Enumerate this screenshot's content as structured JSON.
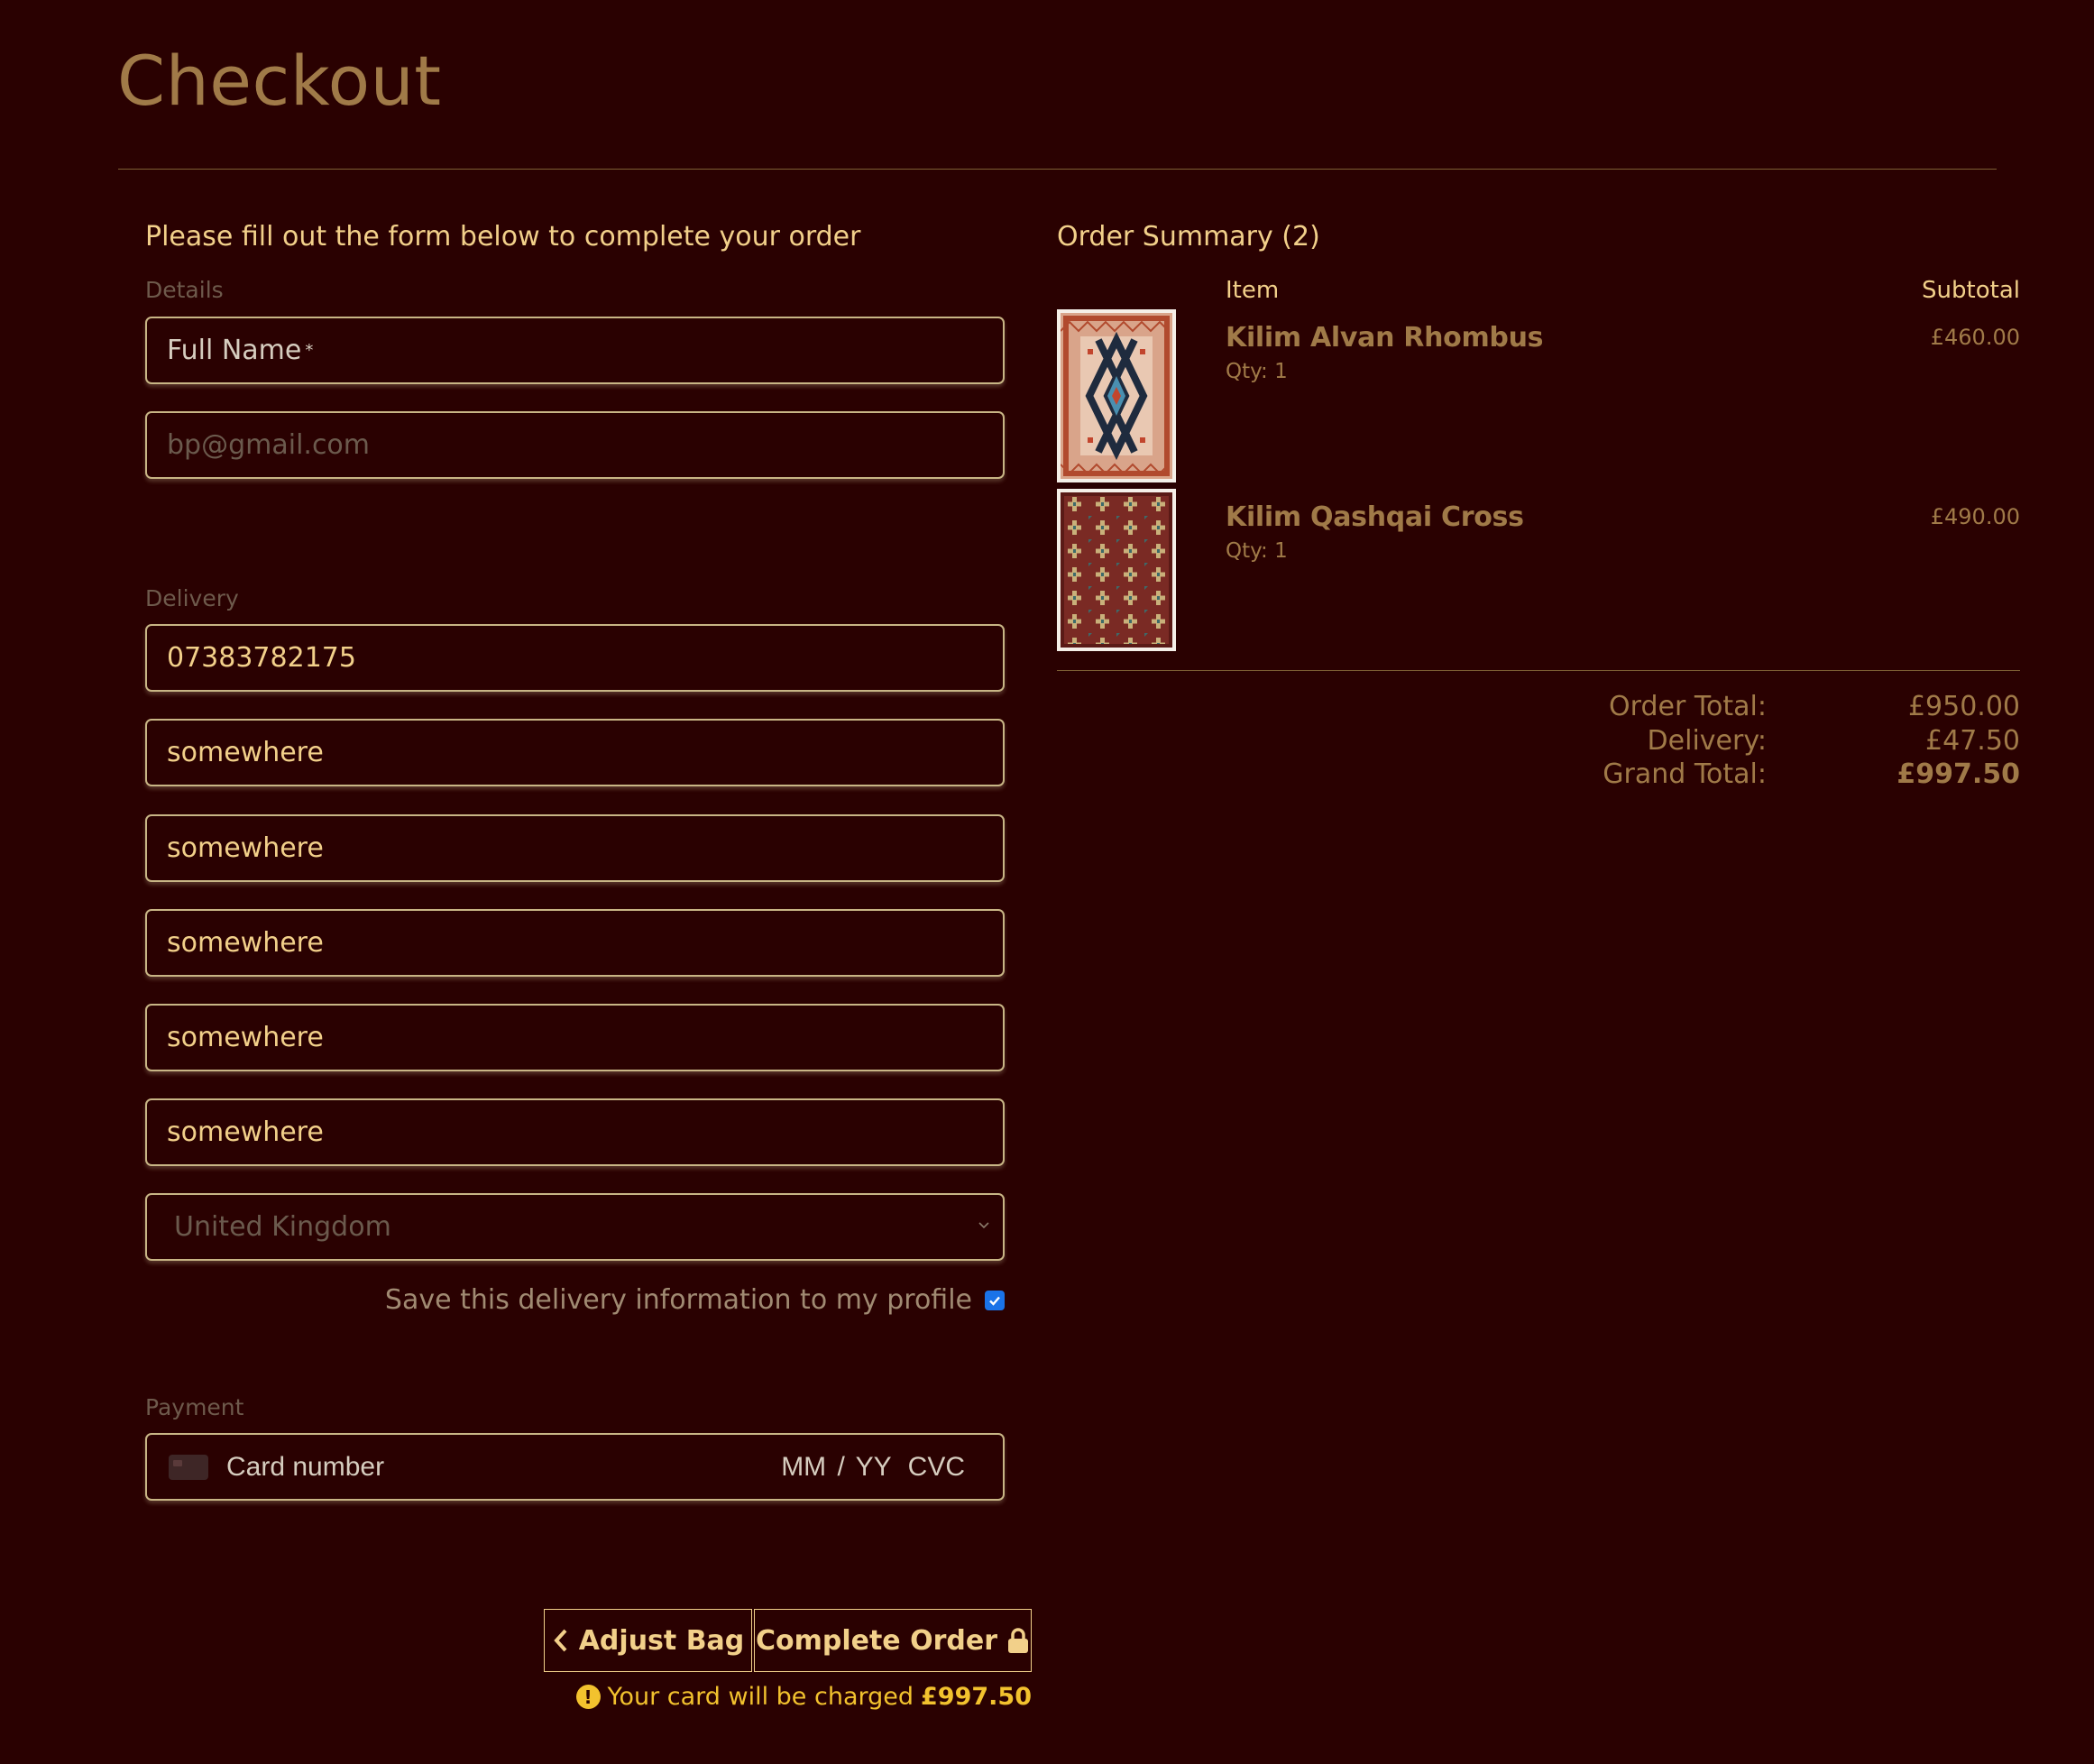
{
  "page": {
    "title": "Checkout"
  },
  "form": {
    "intro": "Please fill out the form below to complete your order",
    "details": {
      "legend": "Details",
      "full_name": {
        "placeholder": "Full Name",
        "required_mark": "*"
      },
      "email": {
        "placeholder": "bp@gmail.com"
      }
    },
    "delivery": {
      "legend": "Delivery",
      "phone": "07383782175",
      "street_address1": "somewhere",
      "street_address2": "somewhere",
      "town_or_city": "somewhere",
      "county": "somewhere",
      "postcode": "somewhere",
      "country": "United Kingdom",
      "save_info_label": "Save this delivery information to my profile",
      "save_info_checked": true
    },
    "payment": {
      "legend": "Payment",
      "card_number_placeholder": "Card number",
      "expiry_placeholder": "MM / YY",
      "cvc_placeholder": "CVC"
    },
    "buttons": {
      "adjust_bag": "Adjust Bag",
      "complete_order": "Complete Order"
    },
    "charge_note": {
      "text": "Your card will be charged",
      "amount": "£997.50"
    }
  },
  "summary": {
    "title": "Order Summary (2)",
    "col_item": "Item",
    "col_subtotal": "Subtotal",
    "items": [
      {
        "name": "Kilim Alvan Rhombus",
        "qty": "Qty: 1",
        "subtotal": "£460.00",
        "image": "kilim-alvan-rhombus-rug-image"
      },
      {
        "name": "Kilim Qashqai Cross",
        "qty": "Qty: 1",
        "subtotal": "£490.00",
        "image": "kilim-qashqai-cross-rug-image"
      }
    ],
    "totals": {
      "order_total_label": "Order Total:",
      "order_total": "£950.00",
      "delivery_label": "Delivery:",
      "delivery": "£47.50",
      "grand_total_label": "Grand Total:",
      "grand_total": "£997.50"
    }
  },
  "colors": {
    "background": "#2a0101",
    "accent": "#f2d08a",
    "muted_gold": "#a07a48",
    "warning": "#f2c22e"
  }
}
